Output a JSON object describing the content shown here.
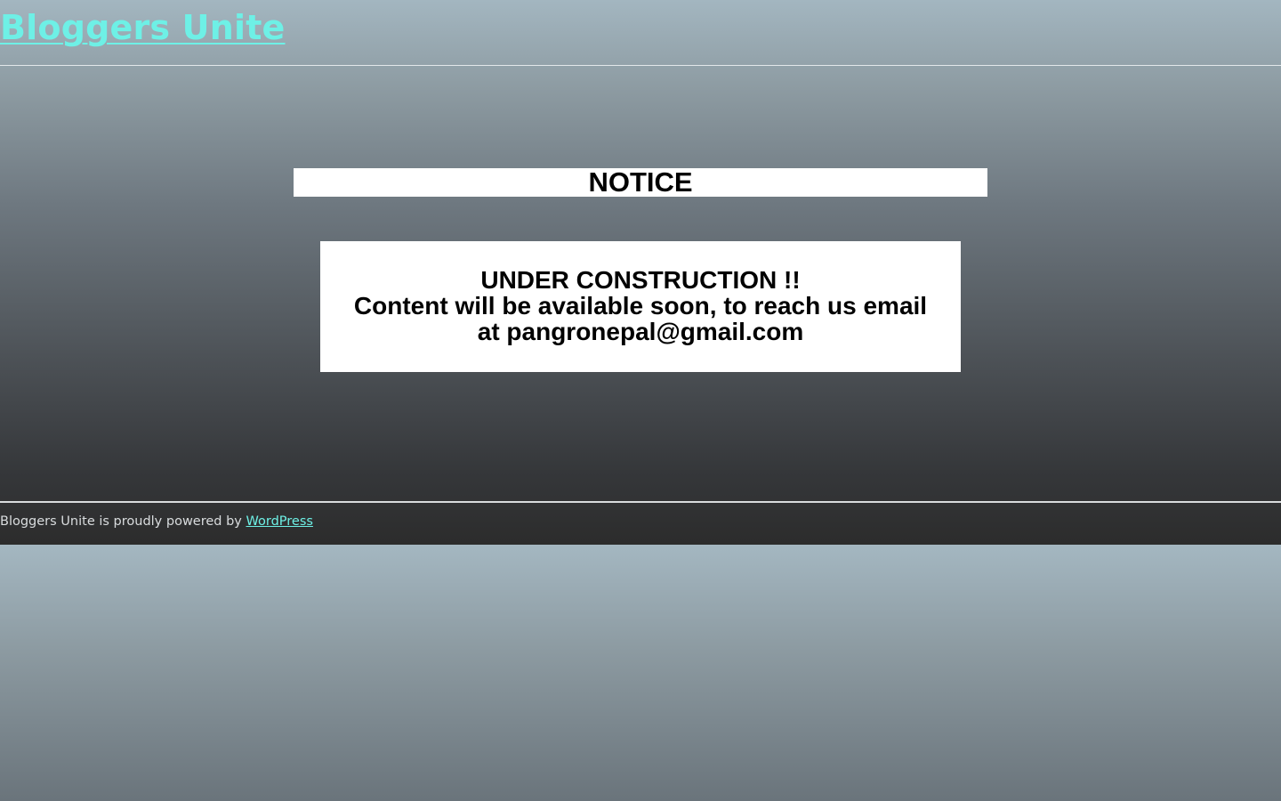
{
  "header": {
    "site_title": "Bloggers Unite"
  },
  "notice": {
    "heading": "NOTICE",
    "line1": "UNDER CONSTRUCTION !!",
    "line2": "Content will be available soon, to reach us email",
    "line3": "at pangronepal@gmail.com"
  },
  "footer": {
    "powered_text": "Bloggers Unite is proudly powered by ",
    "link_label": "WordPress"
  },
  "colors": {
    "accent": "#6ef0e6",
    "footer_text": "#d9dcde",
    "panel_bg": "#ffffff"
  }
}
